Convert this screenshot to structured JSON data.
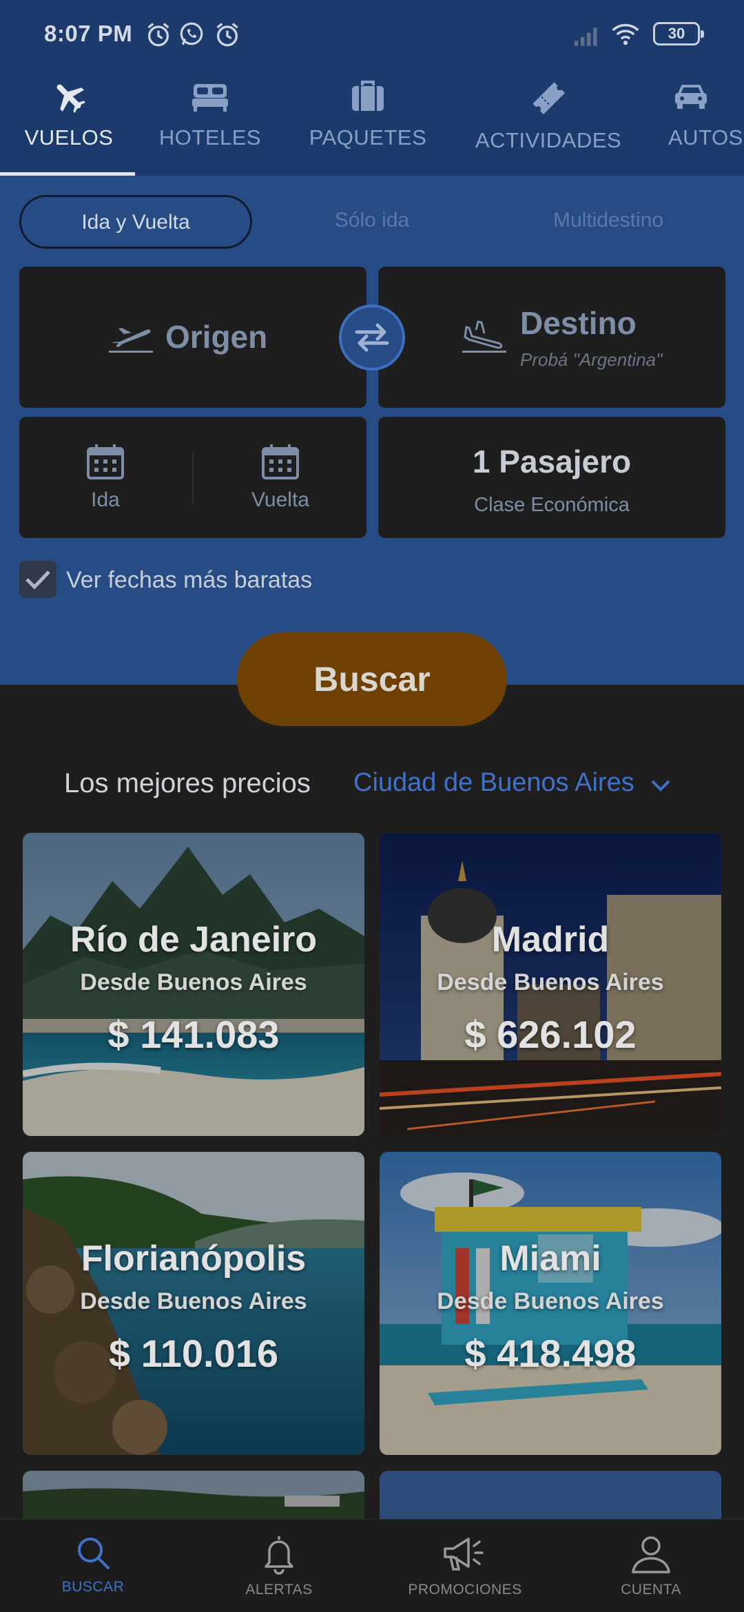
{
  "status_bar": {
    "time": "8:07 PM",
    "icons": [
      "alarm-icon",
      "whatsapp-icon",
      "alarm-icon",
      "signal-icon",
      "wifi-icon"
    ],
    "battery": "30"
  },
  "tabs": [
    {
      "label": "VUELOS",
      "icon": "airplane-icon",
      "active": true
    },
    {
      "label": "HOTELES",
      "icon": "bed-icon"
    },
    {
      "label": "PAQUETES",
      "icon": "suitcase-icon"
    },
    {
      "label": "ACTIVIDADES",
      "icon": "ticket-icon"
    },
    {
      "label": "AUTOS",
      "icon": "car-icon"
    }
  ],
  "trip_types": [
    {
      "label": "Ida y Vuelta",
      "active": true
    },
    {
      "label": "Sólo ida"
    },
    {
      "label": "Multidestino"
    }
  ],
  "search": {
    "origin_label": "Origen",
    "destination_label": "Destino",
    "destination_hint": "Probá \"Argentina\"",
    "departure_label": "Ida",
    "return_label": "Vuelta",
    "passengers": "1 Pasajero",
    "cabin_class": "Clase Económica",
    "cheapest_dates_label": "Ver fechas más baratas",
    "cheapest_dates_checked": true,
    "button_label": "Buscar"
  },
  "best_prices": {
    "title": "Los mejores precios",
    "city": "Ciudad de Buenos Aires",
    "cards": [
      {
        "title": "Río de Janeiro",
        "subtitle": "Desde Buenos Aires",
        "price": "$ 141.083"
      },
      {
        "title": "Madrid",
        "subtitle": "Desde Buenos Aires",
        "price": "$ 626.102"
      },
      {
        "title": "Florianópolis",
        "subtitle": "Desde Buenos Aires",
        "price": "$ 110.016"
      },
      {
        "title": "Miami",
        "subtitle": "Desde Buenos Aires",
        "price": "$ 418.498"
      }
    ]
  },
  "bottom_nav": [
    {
      "label": "BUSCAR",
      "icon": "search-icon",
      "active": true
    },
    {
      "label": "ALERTAS",
      "icon": "bell-icon"
    },
    {
      "label": "PROMOCIONES",
      "icon": "megaphone-icon"
    },
    {
      "label": "CUENTA",
      "icon": "user-icon"
    }
  ],
  "colors": {
    "header_bg": "#1c3a6b",
    "panel_bg": "#264b85",
    "accent_blue": "#3f72c8",
    "search_button": "#6e4002",
    "field_bg": "#1e1e1f"
  }
}
